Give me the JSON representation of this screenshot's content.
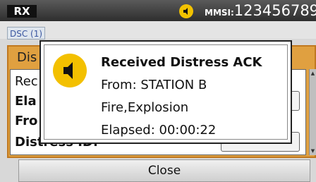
{
  "status_bar": {
    "mode": "RX",
    "mmsi_label": "MMSI:",
    "mmsi_value": "123456789"
  },
  "tabs": {
    "dsc": "DSC (1)"
  },
  "background_window": {
    "title": "Dis",
    "lines": [
      "Rec",
      "Ela",
      "Fro",
      "Distress ID:"
    ]
  },
  "popup": {
    "title": "Received Distress ACK",
    "from": "From: STATION B",
    "nature": "Fire,Explosion",
    "elapsed": "Elapsed: 00:00:22"
  },
  "buttons": {
    "close": "Close"
  },
  "colors": {
    "accent": "#f2c200",
    "window_title": "#e0a040"
  }
}
